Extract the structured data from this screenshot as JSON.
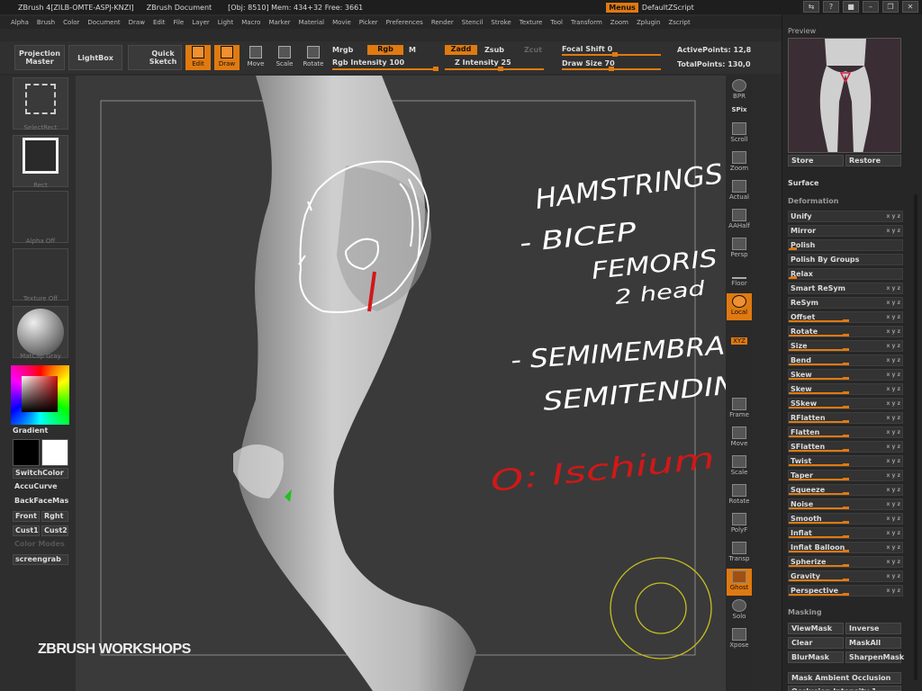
{
  "titlebar": {
    "app": "ZBrush 4[ZILB-OMTE-ASPJ-KNZI]",
    "document": "ZBrush Document",
    "stats": "[Obj: 8510] Mem: 434+32 Free: 3661",
    "menus_button": "Menus",
    "script": "DefaultZScript"
  },
  "menubar": [
    "Alpha",
    "Brush",
    "Color",
    "Document",
    "Draw",
    "Edit",
    "File",
    "Layer",
    "Light",
    "Macro",
    "Marker",
    "Material",
    "Movie",
    "Picker",
    "Preferences",
    "Render",
    "Stencil",
    "Stroke",
    "Texture",
    "Tool",
    "Transform",
    "Zoom",
    "Zplugin",
    "Zscript"
  ],
  "toolbar": {
    "projection_master": "Projection Master",
    "lightbox": "LightBox",
    "quick_sketch": "Quick Sketch",
    "tools": [
      "Edit",
      "Draw",
      "Move",
      "Scale",
      "Rotate"
    ],
    "mrgb": "Mrgb",
    "rgb": "Rgb",
    "m": "M",
    "rgb_intensity": "Rgb Intensity 100",
    "zadd": "Zadd",
    "zsub": "Zsub",
    "zcut": "Zcut",
    "z_intensity": "Z Intensity 25",
    "focal_shift": "Focal Shift 0",
    "draw_size": "Draw Size 70",
    "active_points": "ActivePoints: 12,8",
    "total_points": "TotalPoints: 130,0"
  },
  "left_shelf": {
    "tiles": [
      "SelectRect",
      "Rect",
      "Alpha Off",
      "Texture Off",
      "MatCap Gray"
    ],
    "gradient": "Gradient",
    "switch_color": "SwitchColor",
    "accucurve": "AccuCurve",
    "backfacemask": "BackFaceMas",
    "front": "Front",
    "right": "Rght",
    "cust1": "Cust1",
    "cust2": "Cust2",
    "color_mode": "Color Modes",
    "screengrab": "screengrab"
  },
  "right_shelf": [
    "BPR",
    "SPix",
    "Scroll",
    "Zoom",
    "Actual",
    "AAHalf",
    "Persp",
    "Floor",
    "Local",
    "XYZ",
    "Frame",
    "Move",
    "Scale",
    "Rotate",
    "PolyF",
    "Transp",
    "Ghost",
    "Solo",
    "Xpose"
  ],
  "canvas_notes": {
    "hamstrings": "HAMSTRINGS",
    "bicep": "- BICEP",
    "femoris": "FEMORIS",
    "two_head": "2 head",
    "semimembranous": "- SEMIMEMBRANEOUS",
    "semitendinous": "SEMITENDINOUS",
    "origin": "O: Ischium"
  },
  "watermark": "ZBRUSH WORKSHOPS",
  "right_panel": {
    "preview": "Preview",
    "store": "Store",
    "restore": "Restore",
    "surface": "Surface",
    "deformation": "Deformation",
    "deform_items": [
      {
        "label": "Unify",
        "marks": "x y z"
      },
      {
        "label": "Mirror",
        "marks": "x y z"
      },
      {
        "label": "Polish",
        "marks": ""
      },
      {
        "label": "Polish By Groups",
        "marks": ""
      },
      {
        "label": "Relax",
        "marks": ""
      },
      {
        "label": "Smart ReSym",
        "marks": "x y z"
      },
      {
        "label": "ReSym",
        "marks": "x y z"
      },
      {
        "label": "Offset",
        "marks": "x y z"
      },
      {
        "label": "Rotate",
        "marks": "x y z"
      },
      {
        "label": "Size",
        "marks": "x y z"
      },
      {
        "label": "Bend",
        "marks": "x y z"
      },
      {
        "label": "Skew",
        "marks": "x y z"
      },
      {
        "label": "Skew",
        "marks": "x y z"
      },
      {
        "label": "SSkew",
        "marks": "x y z"
      },
      {
        "label": "RFlatten",
        "marks": "x y z"
      },
      {
        "label": "Flatten",
        "marks": "x y z"
      },
      {
        "label": "SFlatten",
        "marks": "x y z"
      },
      {
        "label": "Twist",
        "marks": "x y z"
      },
      {
        "label": "Taper",
        "marks": "x y z"
      },
      {
        "label": "Squeeze",
        "marks": "x y z"
      },
      {
        "label": "Noise",
        "marks": "x y z"
      },
      {
        "label": "Smooth",
        "marks": "x y z"
      },
      {
        "label": "Inflat",
        "marks": "x y z"
      },
      {
        "label": "Inflat Balloon",
        "marks": "x y z"
      },
      {
        "label": "Spherize",
        "marks": "x y z"
      },
      {
        "label": "Gravity",
        "marks": "x y z"
      },
      {
        "label": "Perspective",
        "marks": "x y z"
      }
    ],
    "masking": "Masking",
    "view_mask": "ViewMask",
    "inverse": "Inverse",
    "clear": "Clear",
    "mask_all": "MaskAll",
    "blur_mask": "BlurMask",
    "sharpen_mask": "SharpenMask",
    "mask_ambient_occlusion": "Mask Ambient Occlusion",
    "occlusion_intensity": "Occlusion Intensity 1"
  },
  "colors": {
    "accent": "#e07a10",
    "annotation_white": "#ffffff",
    "annotation_red": "#d01818",
    "mesh": "#c9c9c9"
  }
}
